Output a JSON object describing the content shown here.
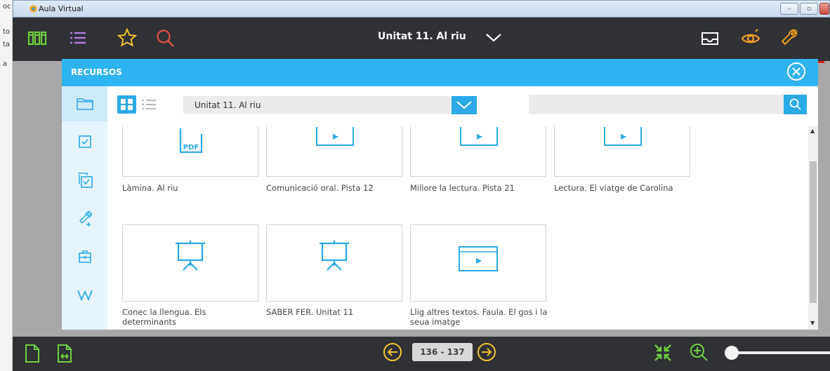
{
  "window": {
    "title": "Aula Virtual"
  },
  "left_edge": {
    "fragments": [
      "oc",
      "to",
      "ta",
      "a"
    ]
  },
  "topbar": {
    "unit_title": "Unitat 11. Al riu"
  },
  "modal": {
    "title": "RECURSOS",
    "sidebar_items": [
      {
        "icon": "folder-icon",
        "active": true
      },
      {
        "icon": "checkbox-icon",
        "active": false
      },
      {
        "icon": "stacked-checkbox-icon",
        "active": false
      },
      {
        "icon": "tools-add-icon",
        "active": false
      },
      {
        "icon": "briefcase-icon",
        "active": false
      },
      {
        "icon": "w-letter-icon",
        "active": false
      }
    ],
    "select": {
      "value": "Unitat 11. Al riu"
    },
    "search": {
      "placeholder": ""
    },
    "resources": [
      {
        "label": "Làmina. Al riu",
        "icon": "pdf-icon"
      },
      {
        "label": "Comunicació oral. Pista 12",
        "icon": "video-icon"
      },
      {
        "label": "Millore la lectura. Pista 21",
        "icon": "video-icon"
      },
      {
        "label": "Lectura. El viatge de Carolina",
        "icon": "video-icon"
      },
      {
        "label": "Conec la llengua. Els determinants",
        "icon": "presentation-icon"
      },
      {
        "label": "SABER FER. Unitat 11",
        "icon": "presentation-icon"
      },
      {
        "label": "Llig altres textos. Faula. El gos i la seua imatge",
        "icon": "video-icon"
      }
    ]
  },
  "bottombar": {
    "page_range": "136 - 137"
  },
  "colors": {
    "accent": "#2ba9e8",
    "header": "#2fb4f1",
    "bar": "#2f3135",
    "topbar_icon": "#f0a020"
  }
}
